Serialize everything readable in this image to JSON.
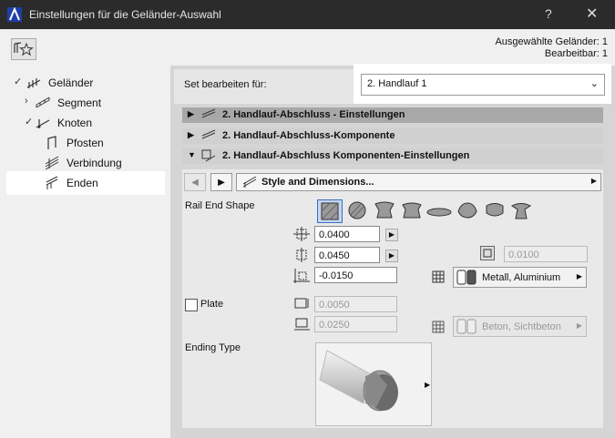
{
  "window": {
    "title": "Einstellungen für die Geländer-Auswahl",
    "help_label": "?",
    "close_label": "✕"
  },
  "selection_info": {
    "selected": "Ausgewählte Geländer: 1",
    "editable": "Bearbeitbar: 1"
  },
  "tree": {
    "items": [
      {
        "label": "Geländer"
      },
      {
        "label": "Segment"
      },
      {
        "label": "Knoten"
      },
      {
        "label": "Pfosten"
      },
      {
        "label": "Verbindung"
      },
      {
        "label": "Enden"
      }
    ]
  },
  "edit_set": {
    "label": "Set bearbeiten für:",
    "value": "2. Handlauf 1"
  },
  "sections": [
    {
      "label": "2. Handlauf-Abschluss - Einstellungen"
    },
    {
      "label": "2. Handlauf-Abschluss-Komponente"
    },
    {
      "label": "2. Handlauf-Abschluss Komponenten-Einstellungen"
    }
  ],
  "nav": {
    "prev": "◀",
    "next": "▶",
    "page": "Style and Dimensions...",
    "more": "▶"
  },
  "rail_end": {
    "label": "Rail End Shape",
    "field1": "0.0400",
    "field2": "0.0450",
    "field3": "-0.0150",
    "field4": "0.0100",
    "material": "Metall, Aluminium"
  },
  "plate": {
    "label": "Plate",
    "field1": "0.0050",
    "field2": "0.0250",
    "material": "Beton, Sichtbeton"
  },
  "ending_type": {
    "label": "Ending Type"
  }
}
